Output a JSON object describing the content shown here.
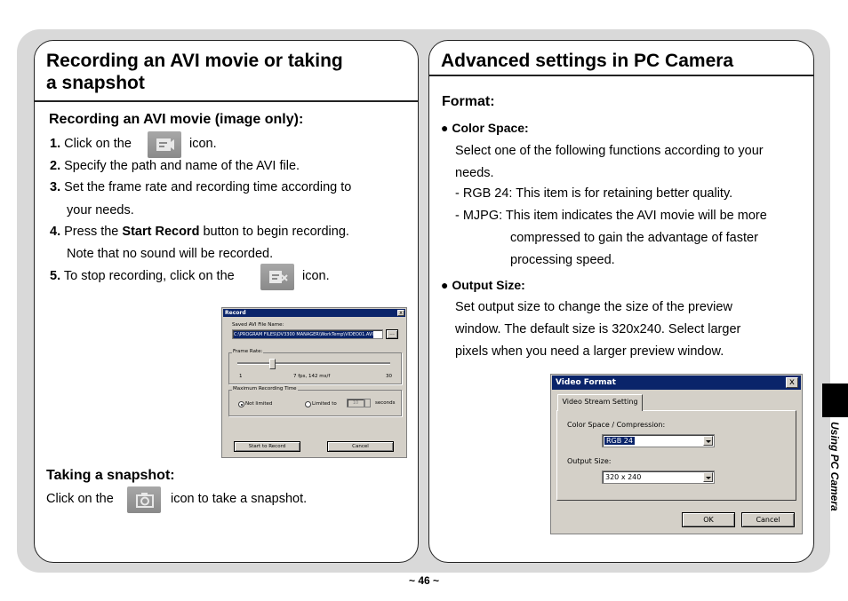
{
  "left": {
    "title_line1": "Recording an AVI movie or taking",
    "title_line2": "a snapshot",
    "section1_heading": "Recording an AVI movie (image only):",
    "steps": [
      {
        "num": "1.",
        "pre": "Click on the",
        "post": "icon."
      },
      {
        "num": "2.",
        "text": "Specify the path and name of the AVI file."
      },
      {
        "num": "3.",
        "text": "Set the frame rate and recording time according to",
        "cont": "your needs."
      },
      {
        "num": "4.",
        "pre": "Press the",
        "bold": "Start Record",
        "post": "button to begin recording.",
        "cont": "Note that no sound will be recorded."
      },
      {
        "num": "5.",
        "pre": "To stop recording, click on the",
        "post": "icon."
      }
    ],
    "section2_heading": "Taking a snapshot:",
    "snapshot_pre": "Click on the",
    "snapshot_post": "icon to take a snapshot."
  },
  "record_dialog": {
    "title": "Record",
    "close": "x",
    "saved_label": "Saved AVI File Name:",
    "saved_value": "C:\\PROGRAM FILES\\DV3300 MANAGER\\WorkTemp\\VIDEO01.AVI",
    "browse": "...",
    "frame_rate_label": "Frame Rate:",
    "frame_min": "1",
    "frame_mid": "7 fps, 142 ms/f",
    "frame_max": "30",
    "max_time_label": "Maximum Recording Time",
    "not_limited": "Not limited",
    "limited_to": "Limited to",
    "limit_value": "10",
    "seconds": "seconds",
    "start_button": "Start to Record",
    "cancel_button": "Cancel"
  },
  "right": {
    "title": "Advanced settings in PC Camera",
    "format_heading": "Format:",
    "color_space_heading": "Color Space:",
    "color_lines": [
      "Select one of the following functions according to your",
      "needs.",
      "- RGB 24: This item is for retaining better quality.",
      "- MJPG: This item indicates the AVI movie will be more"
    ],
    "mjpg_cont": [
      "compressed to gain the advantage of faster",
      "processing speed."
    ],
    "output_size_heading": "Output Size:",
    "output_lines": [
      "Set output size to change the size of the preview",
      "window. The default size is 320x240. Select larger",
      "pixels when you need a larger preview window."
    ]
  },
  "video_dialog": {
    "title": "Video Format",
    "close": "x",
    "tab": "Video Stream Setting",
    "color_label": "Color Space / Compression:",
    "color_value": "RGB 24",
    "output_label": "Output Size:",
    "output_value": "320 x 240",
    "ok": "OK",
    "cancel": "Cancel"
  },
  "side_label": "Using PC Camera",
  "page_number": "~ 46 ~",
  "colors": {
    "panel_border": "#222222",
    "background_band": "#d9d9d9",
    "dialog_titlebar": "#0a246a",
    "dialog_face": "#d4d0c8"
  },
  "icons": {
    "record": "video-camera-icon",
    "stop": "video-camera-stop-icon",
    "snapshot": "camera-icon"
  }
}
